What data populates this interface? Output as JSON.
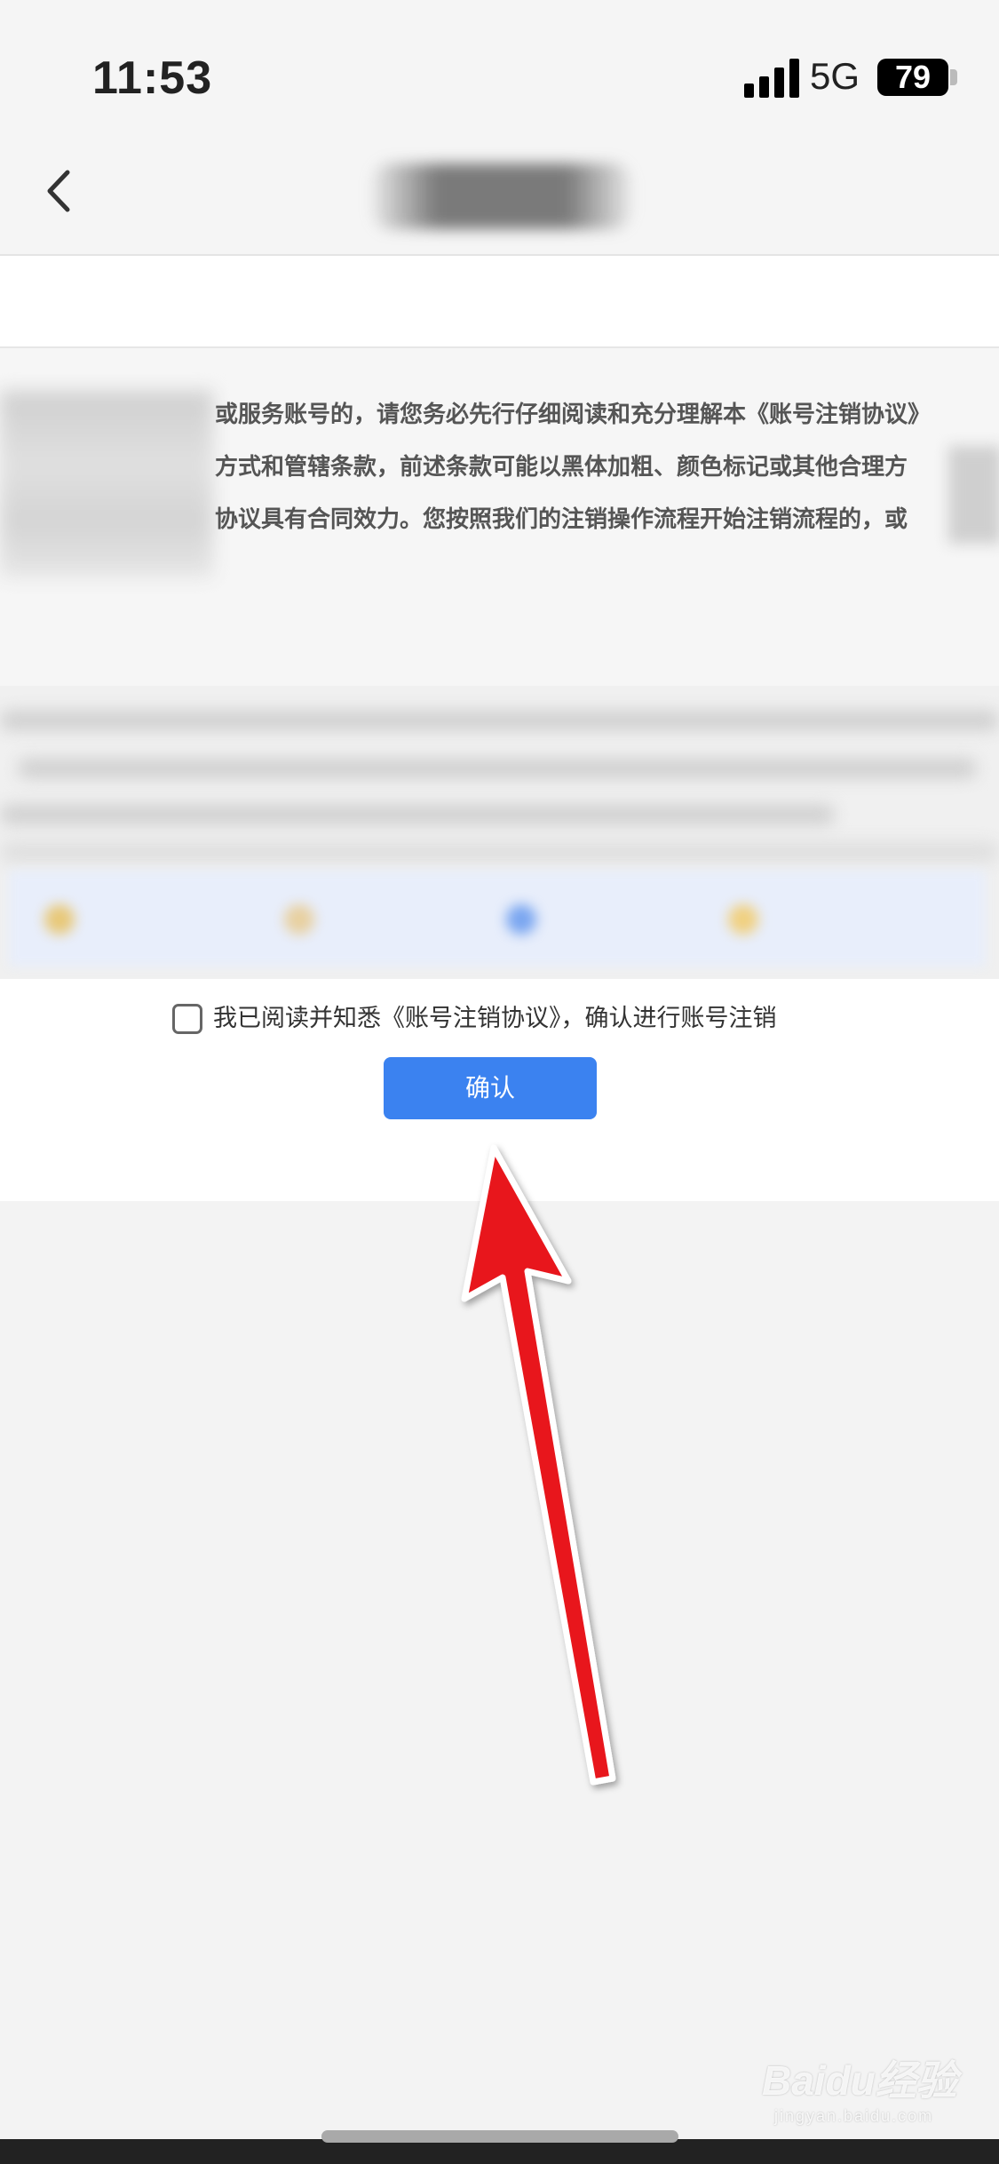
{
  "status_bar": {
    "time": "11:53",
    "network": "5G",
    "battery": "79",
    "icons": [
      "signal-icon",
      "battery-icon"
    ]
  },
  "nav": {
    "back_icon": "chevron-left-icon"
  },
  "agreement": {
    "lines": [
      "或服务账号的，请您务必先行仔细阅读和充分理解本《账号注销协议》",
      "方式和管辖条款，前述条款可能以黑体加粗、颜色标记或其他合理方",
      "协议具有合同效力。您按照我们的注销操作流程开始注销流程的，或"
    ]
  },
  "confirm": {
    "checkbox_checked": false,
    "agree_text": "我已阅读并知悉《账号注销协议》，确认进行账号注销",
    "button_label": "确认",
    "button_color": "#3b82f0"
  },
  "annotation": {
    "arrow_color": "#e8141b",
    "arrow_icon": "red-arrow-icon"
  },
  "watermark": {
    "logo": "Baidu经验",
    "sub": "jingyan.baidu.com"
  }
}
